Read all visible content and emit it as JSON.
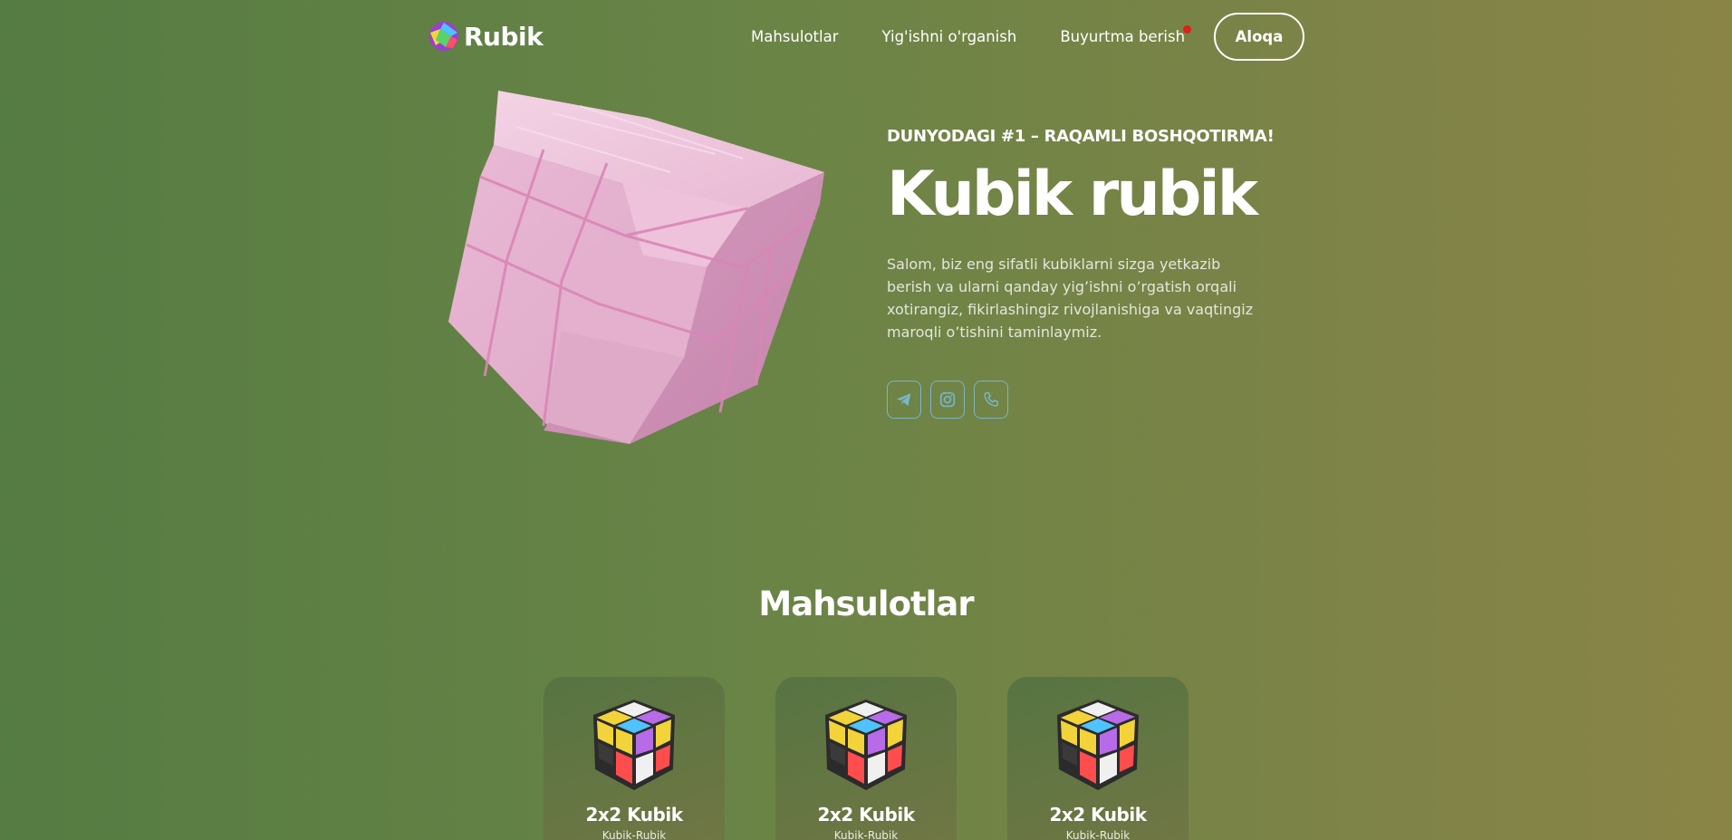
{
  "nav": {
    "logo_text": "Rubik",
    "links": [
      "Mahsulotlar",
      "Yig'ishni o'rganish",
      "Buyurtma berish"
    ],
    "contact_label": "Aloqa"
  },
  "hero": {
    "eyebrow": "DUNYODAGI #1 – RAQAMLI BOSHQOTIRMA!",
    "title": "Kubik rubik",
    "description": "Salom, biz eng sifatli kubiklarni sizga yetkazib berish va ularni qanday yig’ishni o’rgatish orqali xotirangiz, fikirlashingiz rivojlanishiga va vaqtingiz maroqli o’tishini taminlaymiz.",
    "socials": [
      "telegram-icon",
      "instagram-icon",
      "phone-icon"
    ]
  },
  "products": {
    "title": "Mahsulotlar",
    "items": [
      {
        "name": "2x2 Kubik",
        "subtitle": "Kubik-Rubik"
      },
      {
        "name": "2x2 Kubik",
        "subtitle": "Kubik-Rubik"
      },
      {
        "name": "2x2 Kubik",
        "subtitle": "Kubik-Rubik"
      }
    ]
  },
  "colors": {
    "background_start": "#557c43",
    "background_end": "#8a8547",
    "cube_pink": "#e6b6d2",
    "social_border": "#7ab6c8",
    "notification_dot": "#e0201a"
  }
}
